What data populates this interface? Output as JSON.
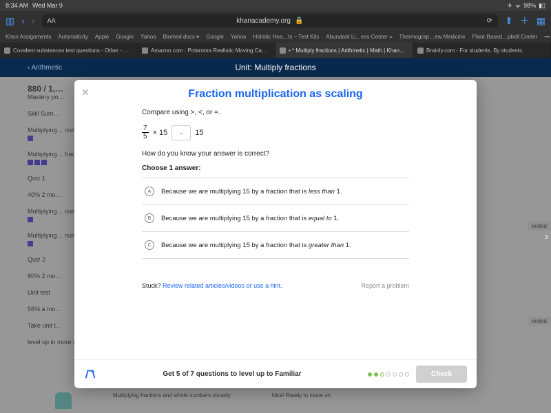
{
  "status": {
    "time": "8:34 AM",
    "date": "Wed Mar 9",
    "battery": "98%"
  },
  "safari": {
    "url": "khanacademy.org",
    "lock": "🔒"
  },
  "bookmarks": [
    "Khan Assignments",
    "Automaticity",
    "Apple",
    "Google",
    "Yahoo",
    "Biomed docs ▾",
    "Google",
    "Yahoo",
    "Holistic Hea…ts – Test Kits",
    "Abundant Li…ess Center »",
    "Thermograp…ew Medicine",
    "Plant-Based…pbell Center"
  ],
  "tabs": [
    {
      "label": "Covalent substances test questions - Other -…"
    },
    {
      "label": "Amazon.com : Potaroma Realistic Moving Ca…"
    },
    {
      "label": "• * Multiply fractions | Arithmetic | Math | Khan…",
      "active": true
    },
    {
      "label": "Brainly.com - For students. By students."
    }
  ],
  "khan": {
    "back": "‹  Arithmetic",
    "unit": "Unit: Multiply fractions"
  },
  "bg": {
    "score": "880 / 1,…",
    "mastery": "Mastery po…",
    "skill": "Skill Sum…",
    "items": [
      "Multiplying… numbers vi…",
      "Multiplying… fractions",
      "Quiz 1",
      "40% 2 mo…",
      "Multiplying… numbers",
      "Multiplying… numbers w…",
      "Quiz 2",
      "80% 2 mo…",
      "Unit test",
      "56% a mo…",
      "Take unit t…",
      "level up in more skills"
    ],
    "rec": "ended",
    "bottom_mid": "Multiplying fractions and whole numbers visually",
    "bottom_right": "Nice! Ready to move on"
  },
  "modal": {
    "title": "Fraction multiplication as scaling",
    "prompt_prefix": "Compare using ",
    "prompt_ops": ">, <, or =.",
    "frac_num": "7",
    "frac_den": "5",
    "times": "× 15",
    "rhs": "15",
    "q2": "How do you know your answer is correct?",
    "choose": "Choose 1 answer:",
    "choices": [
      {
        "letter": "A",
        "pre": "Because we are multiplying 15 by a fraction that is ",
        "em": "less than",
        "post": " 1."
      },
      {
        "letter": "B",
        "pre": "Because we are multiplying 15 by a fraction that is ",
        "em": "equal to",
        "post": " 1."
      },
      {
        "letter": "C",
        "pre": "Because we are multiplying 15 by a fraction that is ",
        "em": "greater than",
        "post": " 1."
      }
    ],
    "stuck_label": "Stuck?",
    "stuck_link": "Review related articles/videos or use a hint.",
    "report": "Report a problem",
    "footer_text": "Get 5 of 7 questions to level up to Familiar",
    "check": "Check",
    "progress": {
      "total": 7,
      "filled": 2,
      "current": 3
    }
  }
}
